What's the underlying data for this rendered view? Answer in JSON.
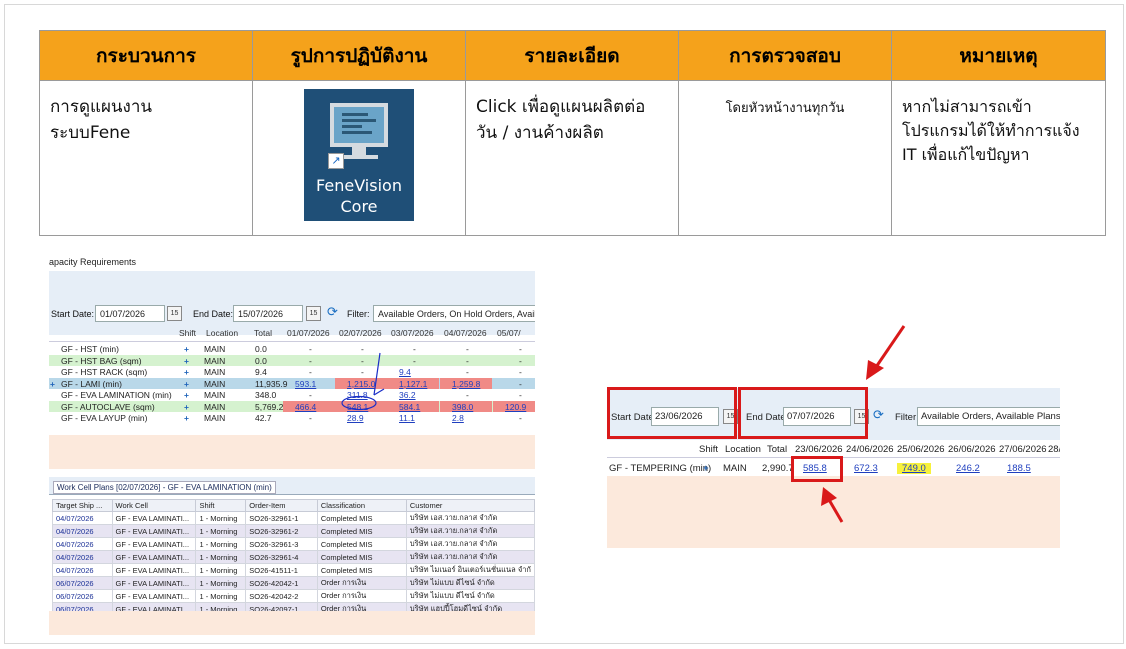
{
  "table": {
    "headers": [
      "กระบวนการ",
      "รูปการปฏิบัติงาน",
      "รายละเอียด",
      "การตรวจสอบ",
      "หมายเหตุ"
    ],
    "row": {
      "process": "การดูแผนงานระบบFene",
      "detail": "Click เพื่อดูแผนผลิตต่อวัน / งานค้างผลิต",
      "check": "โดยหัวหน้างานทุกวัน",
      "note": "หากไม่สามารถเข้าโปรแกรมได้ให้ทำการแจ้ง IT  เพื่อแก้ไขปัญหา",
      "icon_label_1": "FeneVision",
      "icon_label_2": "Core",
      "icon_fragment": "t"
    }
  },
  "left_shot": {
    "title": "apacity Requirements",
    "start_label": "Start Date:",
    "start_value": "01/07/2026",
    "end_label": "End Date:",
    "end_value": "15/07/2026",
    "filter_label": "Filter:",
    "filter_value": "Available Orders, On Hold Orders, Available P",
    "cal": "15",
    "columns": [
      "Shift",
      "Location",
      "Total",
      "01/07/2026",
      "02/07/2026",
      "03/07/2026",
      "04/07/2026",
      "05/07/"
    ],
    "rows": [
      {
        "name": "GF - HST (min)",
        "loc": "MAIN",
        "total": "0.0",
        "v": [
          "-",
          "-",
          "-",
          "-",
          "-"
        ],
        "bg": "#ffffff"
      },
      {
        "name": "GF - HST BAG (sqm)",
        "loc": "MAIN",
        "total": "0.0",
        "v": [
          "-",
          "-",
          "-",
          "-",
          "-"
        ],
        "bg": "#d5f2cf"
      },
      {
        "name": "GF - HST RACK (sqm)",
        "loc": "MAIN",
        "total": "9.4",
        "v": [
          "-",
          "-",
          "9.4",
          "-",
          "-"
        ],
        "bg": "#ffffff"
      },
      {
        "name": "GF - LAMI (min)",
        "loc": "MAIN",
        "total": "11,935.9",
        "v": [
          "593.1",
          "1,215.0",
          "1,127.1",
          "1,259.8",
          "-"
        ],
        "bg": "#b9d8e9"
      },
      {
        "name": "GF - EVA LAMINATION (min)",
        "loc": "MAIN",
        "total": "348.0",
        "v": [
          "-",
          "311.8",
          "36.2",
          "-",
          "-"
        ],
        "bg": "#ffffff"
      },
      {
        "name": "GF - AUTOCLAVE (sqm)",
        "loc": "MAIN",
        "total": "5,769.2",
        "v": [
          "466.4",
          "548.1",
          "584.1",
          "398.0",
          "120.9"
        ],
        "bg": "#d5f2cf"
      },
      {
        "name": "GF - EVA LAYUP (min)",
        "loc": "MAIN",
        "total": "42.7",
        "v": [
          "-",
          "28.9",
          "11.1",
          "2.8",
          "-"
        ],
        "bg": "#ffffff"
      }
    ],
    "work_cell_tab": "Work Cell Plans [02/07/2026] - GF - EVA LAMINATION (min)",
    "wc_columns": [
      "Target Ship ...",
      "Work Cell",
      "Shift",
      "Order-Item",
      "Classification",
      "Customer"
    ],
    "wc_rows": [
      [
        "04/07/2026",
        "GF - EVA LAMINATI...",
        "1 - Morning",
        "SO26-32961-1",
        "Completed MIS",
        "บริษัท เอส.วาย.กลาส จำกัด"
      ],
      [
        "04/07/2026",
        "GF - EVA LAMINATI...",
        "1 - Morning",
        "SO26-32961-2",
        "Completed MIS",
        "บริษัท เอส.วาย.กลาส จำกัด"
      ],
      [
        "04/07/2026",
        "GF - EVA LAMINATI...",
        "1 - Morning",
        "SO26-32961-3",
        "Completed MIS",
        "บริษัท เอส.วาย.กลาส จำกัด"
      ],
      [
        "04/07/2026",
        "GF - EVA LAMINATI...",
        "1 - Morning",
        "SO26-32961-4",
        "Completed MIS",
        "บริษัท เอส.วาย.กลาส จำกัด"
      ],
      [
        "04/07/2026",
        "GF - EVA LAMINATI...",
        "1 - Morning",
        "SO26-41511-1",
        "Completed MIS",
        "บริษัท ไมเนอร์ อินเตอร์เนชั่นแนล จำกั"
      ],
      [
        "06/07/2026",
        "GF - EVA LAMINATI...",
        "1 - Morning",
        "SO26-42042-1",
        "Order การเงิน",
        "บริษัท ไม่แบบ ดีไซน์ จำกัด"
      ],
      [
        "06/07/2026",
        "GF - EVA LAMINATI...",
        "1 - Morning",
        "SO26-42042-2",
        "Order การเงิน",
        "บริษัท ไม่แบบ ดีไซน์ จำกัด"
      ],
      [
        "06/07/2026",
        "GF - EVA LAMINATI...",
        "1 - Morning",
        "SO26-42097-1",
        "Order การเงิน",
        "บริษัท แฮปปี้โฮมดีไซน์ จำกัด"
      ]
    ]
  },
  "right_shot": {
    "start_label": "Start Date:",
    "start_value": "23/06/2026",
    "end_label": "End Date:",
    "end_value": "07/07/2026",
    "filter_label": "Filter:",
    "filter_value": "Available Orders, Available Plans, Acknow",
    "cal": "15",
    "columns": [
      "Shift",
      "Location",
      "Total",
      "23/06/2026",
      "24/06/2026",
      "25/06/2026",
      "26/06/2026",
      "27/06/2026",
      "28/"
    ],
    "row": {
      "name": "GF - TEMPERING (min)",
      "loc": "MAIN",
      "total": "2,990.7",
      "v": [
        "585.8",
        "672.3",
        "749.0",
        "246.2",
        "188.5"
      ]
    }
  },
  "colors": {
    "header_orange": "#f5a21b",
    "highlight_red": "#d9191a",
    "peach": "#fce9dc"
  }
}
